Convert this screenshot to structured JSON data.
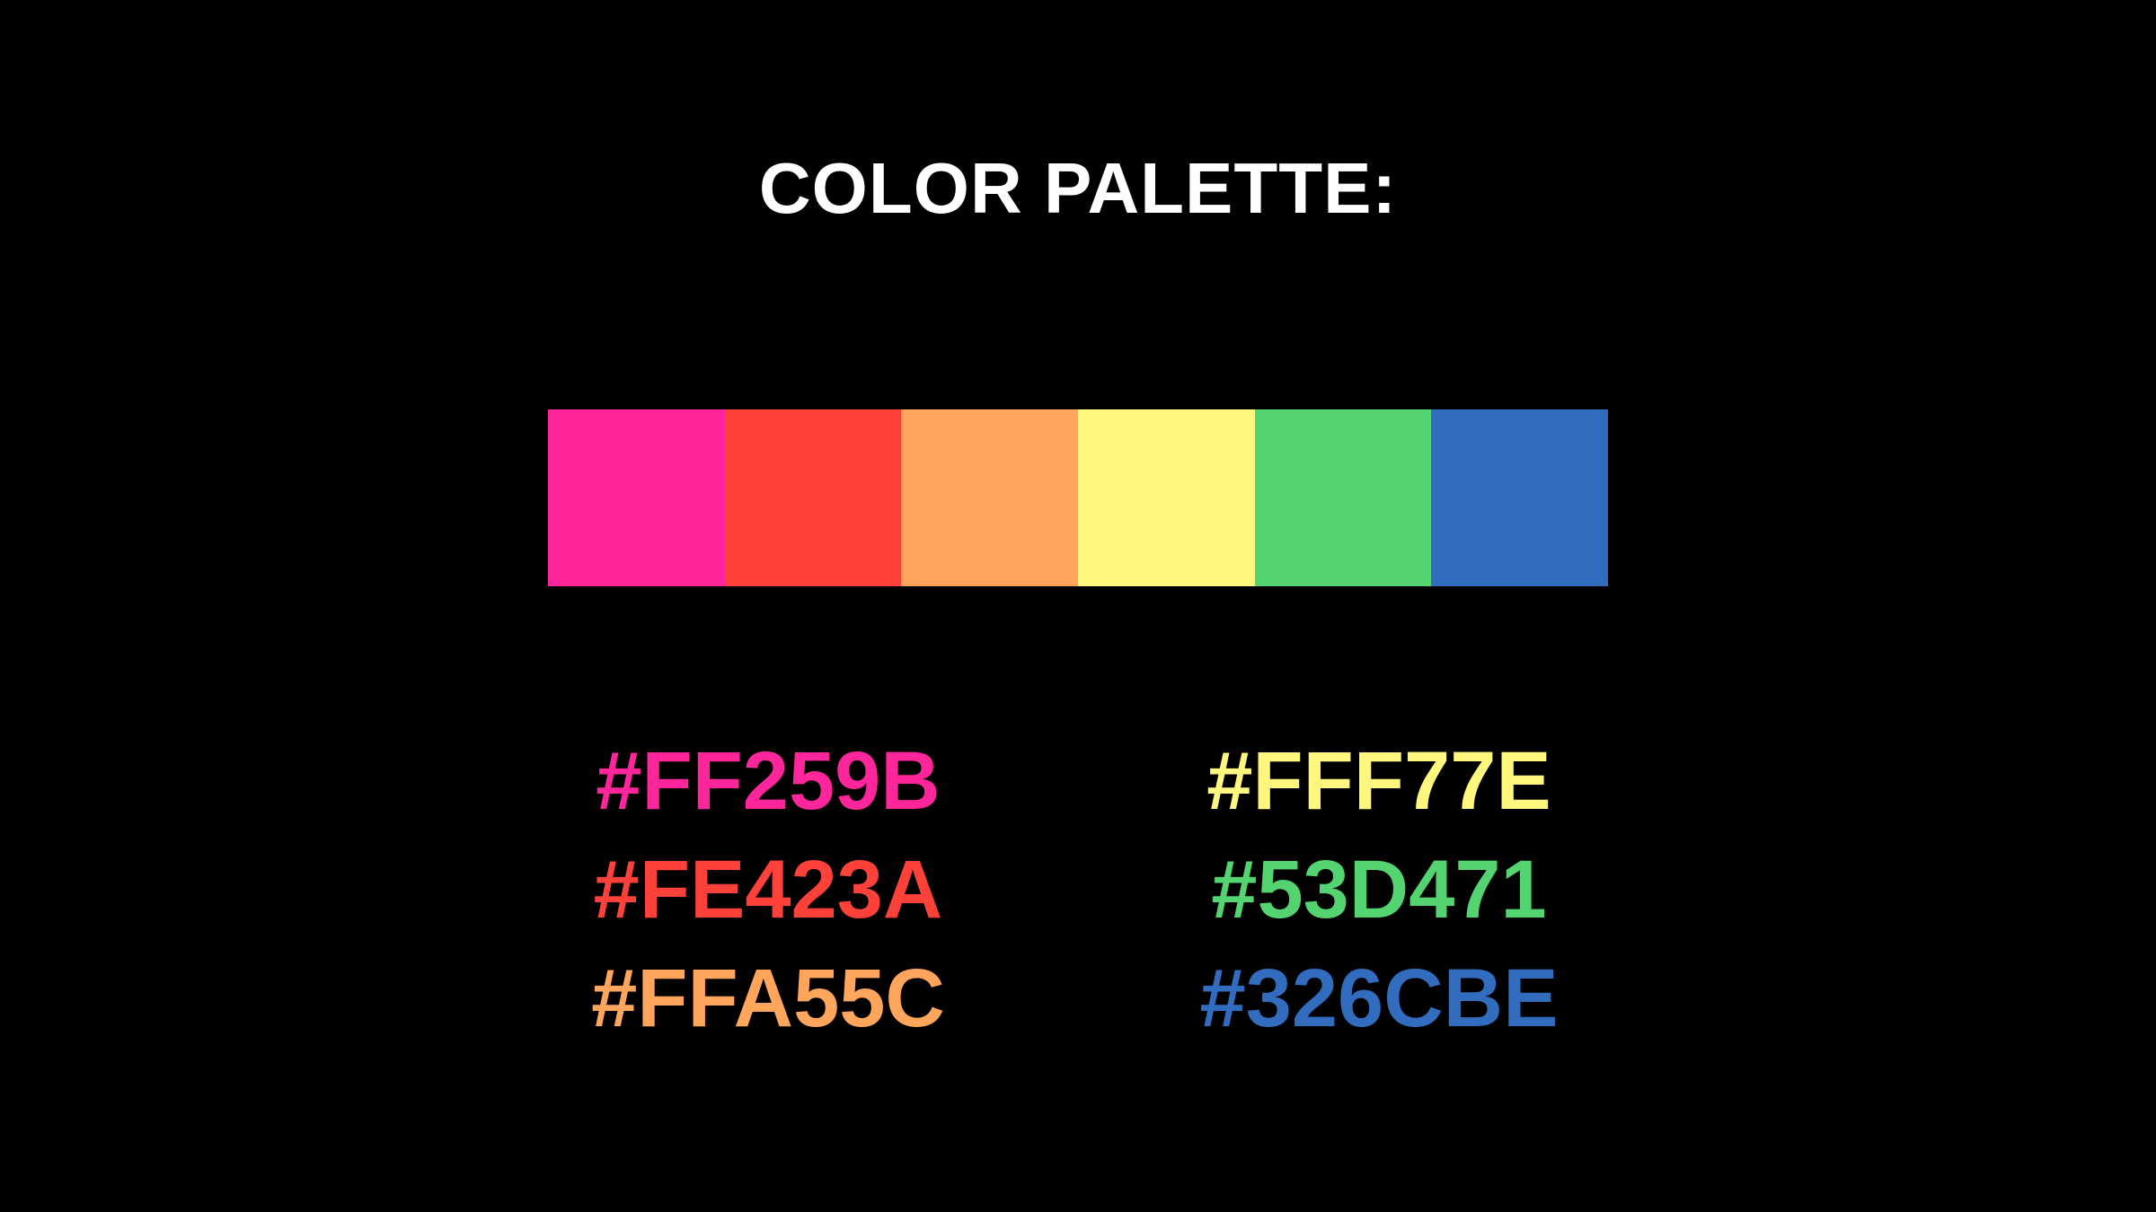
{
  "title": "COLOR PALETTE:",
  "palette": [
    {
      "hex": "#FF259B",
      "color": "#FF259B"
    },
    {
      "hex": "#FE423A",
      "color": "#FE423A"
    },
    {
      "hex": "#FFA55C",
      "color": "#FFA55C"
    },
    {
      "hex": "#FFF77E",
      "color": "#FFF77E"
    },
    {
      "hex": "#53D471",
      "color": "#53D471"
    },
    {
      "hex": "#326CBE",
      "color": "#326CBE"
    }
  ],
  "background": "#000000"
}
